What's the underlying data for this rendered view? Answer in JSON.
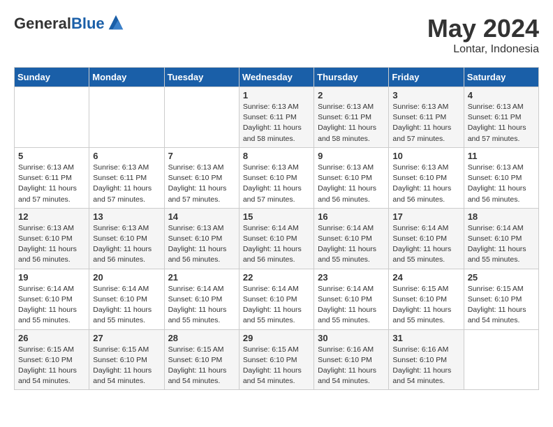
{
  "logo": {
    "general": "General",
    "blue": "Blue"
  },
  "header": {
    "title": "May 2024",
    "subtitle": "Lontar, Indonesia"
  },
  "days_of_week": [
    "Sunday",
    "Monday",
    "Tuesday",
    "Wednesday",
    "Thursday",
    "Friday",
    "Saturday"
  ],
  "weeks": [
    [
      {
        "day": "",
        "info": ""
      },
      {
        "day": "",
        "info": ""
      },
      {
        "day": "",
        "info": ""
      },
      {
        "day": "1",
        "info": "Sunrise: 6:13 AM\nSunset: 6:11 PM\nDaylight: 11 hours and 58 minutes."
      },
      {
        "day": "2",
        "info": "Sunrise: 6:13 AM\nSunset: 6:11 PM\nDaylight: 11 hours and 58 minutes."
      },
      {
        "day": "3",
        "info": "Sunrise: 6:13 AM\nSunset: 6:11 PM\nDaylight: 11 hours and 57 minutes."
      },
      {
        "day": "4",
        "info": "Sunrise: 6:13 AM\nSunset: 6:11 PM\nDaylight: 11 hours and 57 minutes."
      }
    ],
    [
      {
        "day": "5",
        "info": "Sunrise: 6:13 AM\nSunset: 6:11 PM\nDaylight: 11 hours and 57 minutes."
      },
      {
        "day": "6",
        "info": "Sunrise: 6:13 AM\nSunset: 6:11 PM\nDaylight: 11 hours and 57 minutes."
      },
      {
        "day": "7",
        "info": "Sunrise: 6:13 AM\nSunset: 6:10 PM\nDaylight: 11 hours and 57 minutes."
      },
      {
        "day": "8",
        "info": "Sunrise: 6:13 AM\nSunset: 6:10 PM\nDaylight: 11 hours and 57 minutes."
      },
      {
        "day": "9",
        "info": "Sunrise: 6:13 AM\nSunset: 6:10 PM\nDaylight: 11 hours and 56 minutes."
      },
      {
        "day": "10",
        "info": "Sunrise: 6:13 AM\nSunset: 6:10 PM\nDaylight: 11 hours and 56 minutes."
      },
      {
        "day": "11",
        "info": "Sunrise: 6:13 AM\nSunset: 6:10 PM\nDaylight: 11 hours and 56 minutes."
      }
    ],
    [
      {
        "day": "12",
        "info": "Sunrise: 6:13 AM\nSunset: 6:10 PM\nDaylight: 11 hours and 56 minutes."
      },
      {
        "day": "13",
        "info": "Sunrise: 6:13 AM\nSunset: 6:10 PM\nDaylight: 11 hours and 56 minutes."
      },
      {
        "day": "14",
        "info": "Sunrise: 6:13 AM\nSunset: 6:10 PM\nDaylight: 11 hours and 56 minutes."
      },
      {
        "day": "15",
        "info": "Sunrise: 6:14 AM\nSunset: 6:10 PM\nDaylight: 11 hours and 56 minutes."
      },
      {
        "day": "16",
        "info": "Sunrise: 6:14 AM\nSunset: 6:10 PM\nDaylight: 11 hours and 55 minutes."
      },
      {
        "day": "17",
        "info": "Sunrise: 6:14 AM\nSunset: 6:10 PM\nDaylight: 11 hours and 55 minutes."
      },
      {
        "day": "18",
        "info": "Sunrise: 6:14 AM\nSunset: 6:10 PM\nDaylight: 11 hours and 55 minutes."
      }
    ],
    [
      {
        "day": "19",
        "info": "Sunrise: 6:14 AM\nSunset: 6:10 PM\nDaylight: 11 hours and 55 minutes."
      },
      {
        "day": "20",
        "info": "Sunrise: 6:14 AM\nSunset: 6:10 PM\nDaylight: 11 hours and 55 minutes."
      },
      {
        "day": "21",
        "info": "Sunrise: 6:14 AM\nSunset: 6:10 PM\nDaylight: 11 hours and 55 minutes."
      },
      {
        "day": "22",
        "info": "Sunrise: 6:14 AM\nSunset: 6:10 PM\nDaylight: 11 hours and 55 minutes."
      },
      {
        "day": "23",
        "info": "Sunrise: 6:14 AM\nSunset: 6:10 PM\nDaylight: 11 hours and 55 minutes."
      },
      {
        "day": "24",
        "info": "Sunrise: 6:15 AM\nSunset: 6:10 PM\nDaylight: 11 hours and 55 minutes."
      },
      {
        "day": "25",
        "info": "Sunrise: 6:15 AM\nSunset: 6:10 PM\nDaylight: 11 hours and 54 minutes."
      }
    ],
    [
      {
        "day": "26",
        "info": "Sunrise: 6:15 AM\nSunset: 6:10 PM\nDaylight: 11 hours and 54 minutes."
      },
      {
        "day": "27",
        "info": "Sunrise: 6:15 AM\nSunset: 6:10 PM\nDaylight: 11 hours and 54 minutes."
      },
      {
        "day": "28",
        "info": "Sunrise: 6:15 AM\nSunset: 6:10 PM\nDaylight: 11 hours and 54 minutes."
      },
      {
        "day": "29",
        "info": "Sunrise: 6:15 AM\nSunset: 6:10 PM\nDaylight: 11 hours and 54 minutes."
      },
      {
        "day": "30",
        "info": "Sunrise: 6:16 AM\nSunset: 6:10 PM\nDaylight: 11 hours and 54 minutes."
      },
      {
        "day": "31",
        "info": "Sunrise: 6:16 AM\nSunset: 6:10 PM\nDaylight: 11 hours and 54 minutes."
      },
      {
        "day": "",
        "info": ""
      }
    ]
  ]
}
